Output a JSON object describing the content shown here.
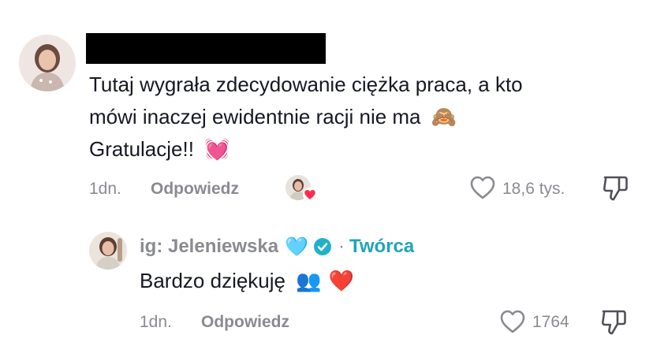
{
  "colors": {
    "text": "#161823",
    "muted": "#8a8b91",
    "creator_accent": "#20a4b8",
    "verified": "#20b1c9",
    "redaction": "#000000"
  },
  "comment": {
    "username_redacted": true,
    "avatar_icon": "user-avatar",
    "text_line1": "Tutaj wygrała zdecydowanie ciężka praca, a kto",
    "text_line2_prefix": "mówi inaczej ewidentnie racji nie ma",
    "text_line2_emoji": "🙈",
    "text_line3_prefix": "Gratulacje!!",
    "text_line3_emoji": "💓",
    "time": "1dn.",
    "reply_label": "Odpowiedz",
    "creator_liked_icon": "creator-liked-avatar",
    "like_icon": "heart-outline-icon",
    "like_count": "18,6 tys.",
    "dislike_icon": "thumbs-down-icon"
  },
  "reply": {
    "avatar_icon": "creator-avatar",
    "username": "ig: Jeleniewska",
    "username_emoji": "🩵",
    "verified_icon": "verified-badge-icon",
    "separator": "·",
    "creator_label": "Twórca",
    "text_prefix": "Bardzo dziękuję",
    "text_emoji_1": "👥",
    "text_emoji_2": "❤️",
    "time": "1dn.",
    "reply_label": "Odpowiedz",
    "like_icon": "heart-outline-icon",
    "like_count": "1764",
    "dislike_icon": "thumbs-down-icon"
  }
}
